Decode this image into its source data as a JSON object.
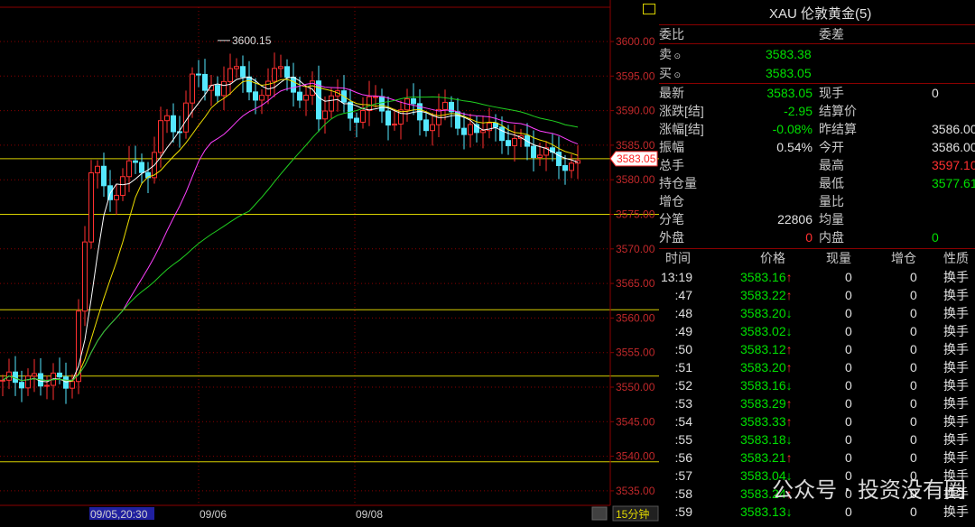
{
  "chart": {
    "high_label": "3600.15",
    "price_tag": "3583.05",
    "period_button": "15分钟",
    "date_labels": [
      {
        "text": "09/05,20:30",
        "highlight": true
      },
      {
        "text": "09/06",
        "highlight": false
      },
      {
        "text": "09/08",
        "highlight": false
      }
    ],
    "y_ticks": [
      "3600.00",
      "3595.00",
      "3590.00",
      "3585.00",
      "3580.00",
      "3575.00",
      "3570.00",
      "3565.00",
      "3560.00",
      "3555.00",
      "3550.00",
      "3545.00",
      "3540.00",
      "3535.00"
    ],
    "colors": {
      "up": "#ff3030",
      "down": "#55e8ff",
      "ma1": "#ffffff",
      "ma2": "#f0e000",
      "ma3": "#ff40ff",
      "ma4": "#20d020",
      "grid": "#8a0000",
      "hline": "#d8d000"
    }
  },
  "chart_data": {
    "type": "candlestick",
    "ylim": [
      3533,
      3603
    ],
    "y_ticks": [
      3600,
      3595,
      3590,
      3585,
      3580,
      3575,
      3570,
      3565,
      3560,
      3555,
      3550,
      3545,
      3540,
      3535
    ],
    "horizontal_lines": [
      3583.05,
      3575.0,
      3561.2,
      3551.6,
      3539.2
    ],
    "last_price": 3583.05,
    "high_marker": 3600.15
  },
  "panel": {
    "title": "XAU 伦敦黄金(5)",
    "weibi_label": "委比",
    "weicha_label": "委差",
    "sell_label": "卖",
    "sell_value": "3583.38",
    "buy_label": "买",
    "buy_value": "3583.05",
    "quote_rows": [
      {
        "l1": "最新",
        "v1": "3583.05",
        "c1": "g",
        "l2": "现手",
        "v2": "0",
        "c2": "w"
      },
      {
        "l1": "涨跌[结]",
        "v1": "-2.95",
        "c1": "g",
        "l2": "结算价",
        "v2": "",
        "c2": "w"
      },
      {
        "l1": "涨幅[结]",
        "v1": "-0.08%",
        "c1": "g",
        "l2": "昨结算",
        "v2": "3586.00",
        "c2": "w"
      },
      {
        "l1": "振幅",
        "v1": "0.54%",
        "c1": "w",
        "l2": "今开",
        "v2": "3586.00",
        "c2": "w"
      },
      {
        "l1": "总手",
        "v1": "",
        "c1": "w",
        "l2": "最高",
        "v2": "3597.10",
        "c2": "r"
      },
      {
        "l1": "持仓量",
        "v1": "",
        "c1": "w",
        "l2": "最低",
        "v2": "3577.61",
        "c2": "g"
      },
      {
        "l1": "增仓",
        "v1": "",
        "c1": "w",
        "l2": "量比",
        "v2": "",
        "c2": "w"
      },
      {
        "l1": "分笔",
        "v1": "22806",
        "c1": "w",
        "l2": "均量",
        "v2": "",
        "c2": "w"
      },
      {
        "l1": "外盘",
        "v1": "0",
        "c1": "r",
        "l2": "内盘",
        "v2": "0",
        "c2": "g"
      }
    ],
    "trade_headers": [
      "时间",
      "价格",
      "现量",
      "增仓",
      "性质"
    ],
    "trades": [
      {
        "time": "13:19",
        "price": "3583.16",
        "dir": "up",
        "qty": "0",
        "oi": "0",
        "nature": "换手"
      },
      {
        "time": ":47",
        "price": "3583.22",
        "dir": "up",
        "qty": "0",
        "oi": "0",
        "nature": "换手"
      },
      {
        "time": ":48",
        "price": "3583.20",
        "dir": "down",
        "qty": "0",
        "oi": "0",
        "nature": "换手"
      },
      {
        "time": ":49",
        "price": "3583.02",
        "dir": "down",
        "qty": "0",
        "oi": "0",
        "nature": "换手"
      },
      {
        "time": ":50",
        "price": "3583.12",
        "dir": "up",
        "qty": "0",
        "oi": "0",
        "nature": "换手"
      },
      {
        "time": ":51",
        "price": "3583.20",
        "dir": "up",
        "qty": "0",
        "oi": "0",
        "nature": "换手"
      },
      {
        "time": ":52",
        "price": "3583.16",
        "dir": "down",
        "qty": "0",
        "oi": "0",
        "nature": "换手"
      },
      {
        "time": ":53",
        "price": "3583.29",
        "dir": "up",
        "qty": "0",
        "oi": "0",
        "nature": "换手"
      },
      {
        "time": ":54",
        "price": "3583.33",
        "dir": "up",
        "qty": "0",
        "oi": "0",
        "nature": "换手"
      },
      {
        "time": ":55",
        "price": "3583.18",
        "dir": "down",
        "qty": "0",
        "oi": "0",
        "nature": "换手"
      },
      {
        "time": ":56",
        "price": "3583.21",
        "dir": "up",
        "qty": "0",
        "oi": "0",
        "nature": "换手"
      },
      {
        "time": ":57",
        "price": "3583.04",
        "dir": "down",
        "qty": "0",
        "oi": "0",
        "nature": "换手"
      },
      {
        "time": ":58",
        "price": "3583.24",
        "dir": "up",
        "qty": "0",
        "oi": "0",
        "nature": "换手"
      },
      {
        "time": ":59",
        "price": "3583.13",
        "dir": "down",
        "qty": "0",
        "oi": "0",
        "nature": "换手"
      }
    ],
    "watermark": "公众号 · 投资没有圈"
  }
}
